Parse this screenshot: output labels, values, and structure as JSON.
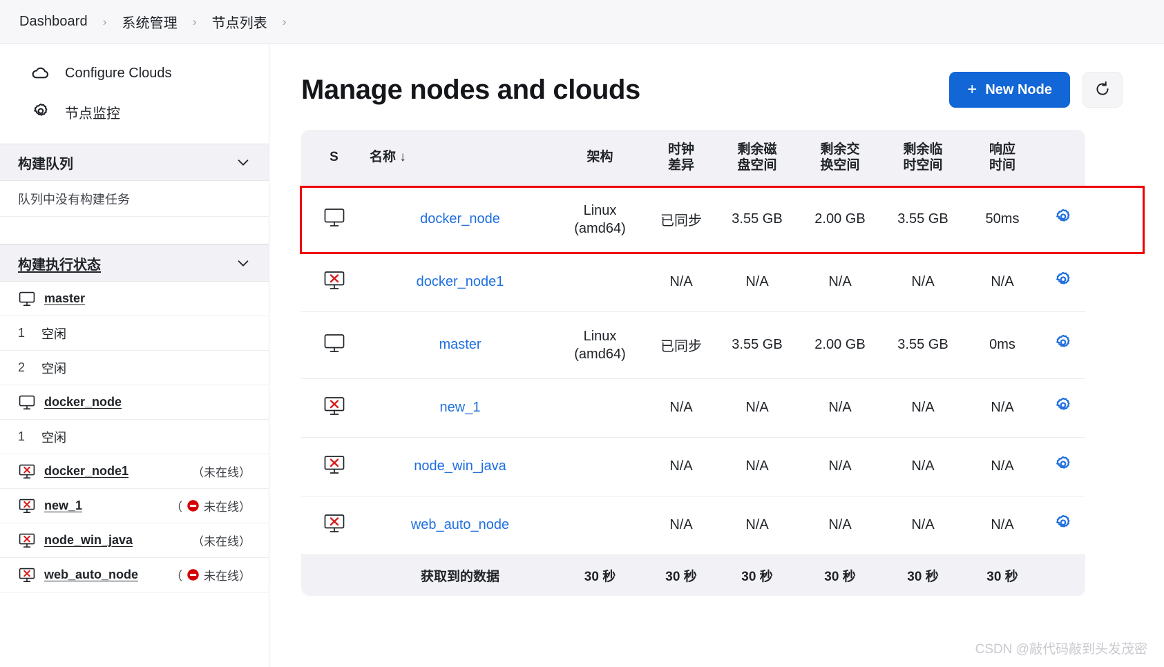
{
  "breadcrumb": {
    "items": [
      "Dashboard",
      "系统管理",
      "节点列表"
    ],
    "separator": "›"
  },
  "sidebar": {
    "links": [
      {
        "label": "Configure Clouds",
        "icon": "cloud-icon"
      },
      {
        "label": "节点监控",
        "icon": "gear-icon"
      }
    ],
    "build_queue": {
      "title": "构建队列",
      "empty_text": "队列中没有构建任务"
    },
    "executor_status": {
      "title": "构建执行状态",
      "rows": [
        {
          "type": "node",
          "name": "master",
          "icon": "monitor-icon",
          "status": ""
        },
        {
          "type": "executor",
          "num": "1",
          "state": "空闲"
        },
        {
          "type": "executor",
          "num": "2",
          "state": "空闲"
        },
        {
          "type": "node",
          "name": "docker_node",
          "icon": "monitor-icon",
          "status": ""
        },
        {
          "type": "executor",
          "num": "1",
          "state": "空闲"
        },
        {
          "type": "node",
          "name": "docker_node1",
          "icon": "monitor-offline-icon",
          "status": "（未在线）",
          "badge": false
        },
        {
          "type": "node",
          "name": "new_1",
          "icon": "monitor-offline-icon",
          "status": "未在线",
          "badge": true
        },
        {
          "type": "node",
          "name": "node_win_java",
          "icon": "monitor-offline-icon",
          "status": "（未在线）",
          "badge": false
        },
        {
          "type": "node",
          "name": "web_auto_node",
          "icon": "monitor-offline-icon",
          "status": "未在线",
          "badge": true
        }
      ]
    }
  },
  "main": {
    "title": "Manage nodes and clouds",
    "new_node_button": "New Node",
    "new_node_plus": "+",
    "refresh_icon": "refresh-icon"
  },
  "table": {
    "columns": [
      "S",
      "名称 ↓",
      "架构",
      "时钟\n差异",
      "剩余磁\n盘空间",
      "剩余交\n换空间",
      "剩余临\n时空间",
      "响应\n时间",
      ""
    ],
    "columns_display": {
      "status": "S",
      "name": "名称 ↓",
      "arch": "架构",
      "clock_l1": "时钟",
      "clock_l2": "差异",
      "disk_l1": "剩余磁",
      "disk_l2": "盘空间",
      "swap_l1": "剩余交",
      "swap_l2": "换空间",
      "tmp_l1": "剩余临",
      "tmp_l2": "时空间",
      "resp_l1": "响应",
      "resp_l2": "时间"
    },
    "rows": [
      {
        "icon": "monitor-icon",
        "name": "docker_node",
        "arch_line1": "Linux",
        "arch_line2": "(amd64)",
        "clock": "已同步",
        "disk": "3.55 GB",
        "swap": "2.00 GB",
        "tmp": "3.55 GB",
        "response": "50ms",
        "gear": "gear-icon",
        "highlighted": true
      },
      {
        "icon": "monitor-offline-icon",
        "name": "docker_node1",
        "arch_line1": "",
        "arch_line2": "",
        "clock": "N/A",
        "disk": "N/A",
        "swap": "N/A",
        "tmp": "N/A",
        "response": "N/A",
        "gear": "gear-icon",
        "highlighted": false
      },
      {
        "icon": "monitor-icon",
        "name": "master",
        "arch_line1": "Linux",
        "arch_line2": "(amd64)",
        "clock": "已同步",
        "disk": "3.55 GB",
        "swap": "2.00 GB",
        "tmp": "3.55 GB",
        "response": "0ms",
        "gear": "gear-icon",
        "highlighted": false
      },
      {
        "icon": "monitor-offline-icon",
        "name": "new_1",
        "arch_line1": "",
        "arch_line2": "",
        "clock": "N/A",
        "disk": "N/A",
        "swap": "N/A",
        "tmp": "N/A",
        "response": "N/A",
        "gear": "gear-icon",
        "highlighted": false
      },
      {
        "icon": "monitor-offline-icon",
        "name": "node_win_java",
        "arch_line1": "",
        "arch_line2": "",
        "clock": "N/A",
        "disk": "N/A",
        "swap": "N/A",
        "tmp": "N/A",
        "response": "N/A",
        "gear": "gear-icon",
        "highlighted": false
      },
      {
        "icon": "monitor-offline-icon",
        "name": "web_auto_node",
        "arch_line1": "",
        "arch_line2": "",
        "clock": "N/A",
        "disk": "N/A",
        "swap": "N/A",
        "tmp": "N/A",
        "response": "N/A",
        "gear": "gear-icon",
        "highlighted": false
      }
    ],
    "footer": {
      "label": "获取到的数据",
      "values": [
        "30 秒",
        "30 秒",
        "30 秒",
        "30 秒",
        "30 秒",
        "30 秒"
      ]
    }
  },
  "watermark": "CSDN @敲代码敲到头发茂密",
  "colors": {
    "accent_blue": "#1266d6",
    "link_blue": "#1f6fe0",
    "highlight_red": "#ee0000",
    "header_bg": "#f2f2f6",
    "offline_red": "#d91c1c"
  }
}
